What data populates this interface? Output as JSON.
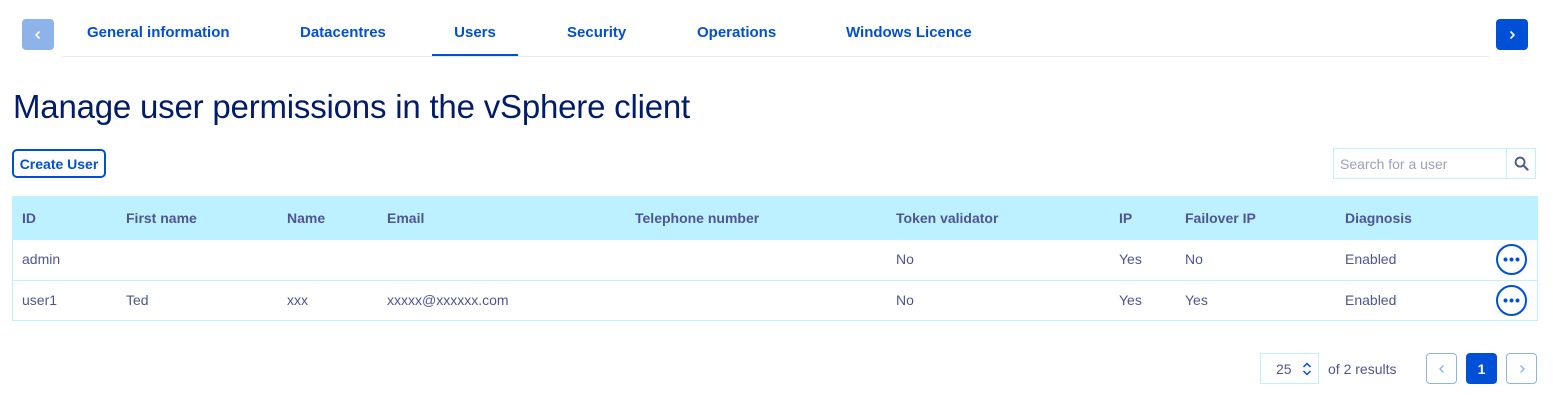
{
  "tabs": [
    {
      "label": "General information",
      "active": false
    },
    {
      "label": "Datacentres",
      "active": false
    },
    {
      "label": "Users",
      "active": true
    },
    {
      "label": "Security",
      "active": false
    },
    {
      "label": "Operations",
      "active": false
    },
    {
      "label": "Windows Licence",
      "active": false
    }
  ],
  "page": {
    "title": "Manage user permissions in the vSphere client",
    "create_button": "Create User",
    "search_placeholder": "Search for a user"
  },
  "table": {
    "headers": [
      "ID",
      "First name",
      "Name",
      "Email",
      "Telephone number",
      "Token validator",
      "IP",
      "Failover IP",
      "Diagnosis"
    ],
    "rows": [
      [
        "admin",
        "",
        "",
        "",
        "",
        "No",
        "Yes",
        "No",
        "Enabled"
      ],
      [
        "user1",
        "Ted",
        "xxx",
        "xxxxx@xxxxxx.com",
        "",
        "No",
        "Yes",
        "Yes",
        "Enabled"
      ]
    ]
  },
  "pagination": {
    "page_size": "25",
    "results_text": "of 2 results",
    "current_page": "1"
  },
  "colors": {
    "accent": "#0050d7",
    "accent_light": "#8db3ea",
    "table_header_bg": "#bef1ff",
    "title": "#001c6b",
    "text": "#4d5693"
  },
  "icons": {
    "nav_prev": "chevron-left-icon",
    "nav_next": "chevron-right-icon",
    "search": "search-icon",
    "row_actions": "ellipsis-icon",
    "page_size_spinner": "sort-arrows-icon"
  }
}
